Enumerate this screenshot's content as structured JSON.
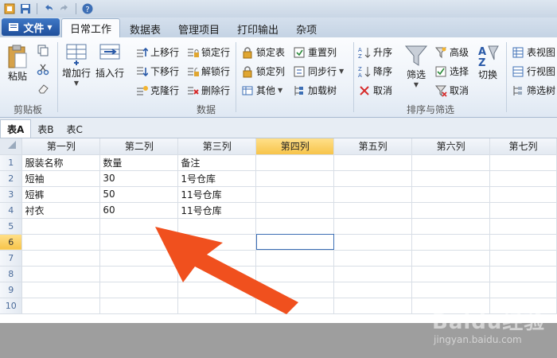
{
  "ribbon_tabs": [
    "日常工作",
    "数据表",
    "管理项目",
    "打印输出",
    "杂项"
  ],
  "file_button": "文件",
  "clipboard": {
    "paste": "粘贴",
    "group_label": "剪贴板"
  },
  "data_group": {
    "add_row": "增加行",
    "insert_row": "插入行",
    "move_up": "上移行",
    "move_down": "下移行",
    "clone_row": "克隆行",
    "lock_row": "锁定行",
    "unlock_row": "解锁行",
    "delete_row": "删除行",
    "lock_table": "锁定表",
    "lock_col": "锁定列",
    "other": "其他",
    "reset_col": "重置列",
    "sync_row": "同步行",
    "load_tree": "加载树",
    "group_label": "数据"
  },
  "sort_group": {
    "asc": "升序",
    "desc": "降序",
    "cancel": "取消",
    "filter": "筛选",
    "advanced": "高级",
    "select": "选择",
    "cancel2": "取消",
    "switch": "切换",
    "group_label": "排序与筛选"
  },
  "view_group": {
    "table_view": "表视图",
    "row_view": "行视图",
    "filter_tree": "筛选树"
  },
  "sheet_tabs": [
    "表A",
    "表B",
    "表C"
  ],
  "columns": [
    "第一列",
    "第二列",
    "第三列",
    "第四列",
    "第五列",
    "第六列",
    "第七列"
  ],
  "selected_column": 3,
  "selected_row": 6,
  "row_numbers": [
    "1",
    "2",
    "3",
    "4",
    "5",
    "6",
    "7",
    "8",
    "9",
    "10"
  ],
  "rows": [
    [
      "服装名称",
      "数量",
      "备注",
      "",
      "",
      "",
      ""
    ],
    [
      "短袖",
      "30",
      "1号仓库",
      "",
      "",
      "",
      ""
    ],
    [
      "短裤",
      "50",
      "11号仓库",
      "",
      "",
      "",
      ""
    ],
    [
      "衬衣",
      "60",
      "11号仓库",
      "",
      "",
      "",
      ""
    ],
    [
      "",
      "",
      "",
      "",
      "",
      "",
      ""
    ],
    [
      "",
      "",
      "",
      "",
      "",
      "",
      ""
    ],
    [
      "",
      "",
      "",
      "",
      "",
      "",
      ""
    ],
    [
      "",
      "",
      "",
      "",
      "",
      "",
      ""
    ],
    [
      "",
      "",
      "",
      "",
      "",
      "",
      ""
    ],
    [
      "",
      "",
      "",
      "",
      "",
      "",
      ""
    ]
  ],
  "watermark": {
    "logo": "Baidu经验",
    "url": "jingyan.baidu.com"
  },
  "colors": {
    "accent": "#2a5aa8",
    "arrow": "#f0501e",
    "selected_header": "#f7c44a"
  }
}
